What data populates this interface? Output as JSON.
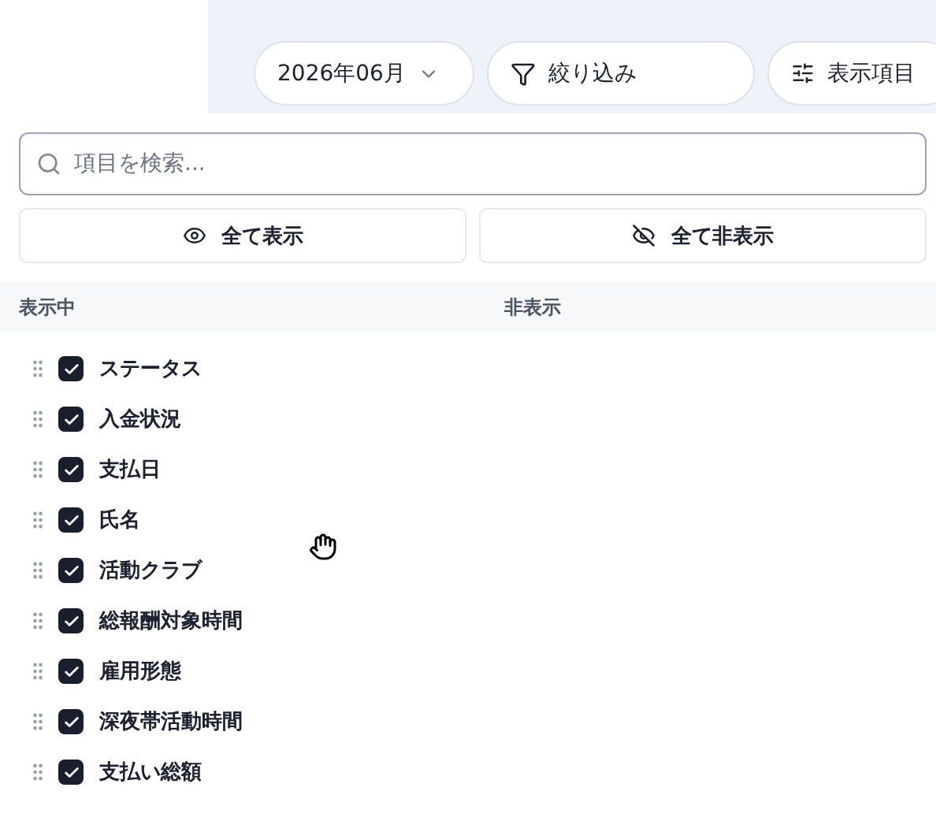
{
  "toolbar": {
    "month": "2026年06月",
    "filter": "絞り込み",
    "columns_button": "表示項目"
  },
  "popup": {
    "search": {
      "placeholder": "項目を検索..."
    },
    "buttons": [
      {
        "kind": "show",
        "label": "全て表示"
      },
      {
        "kind": "hide",
        "label": "全て非表示"
      }
    ],
    "headers": [
      "表示中",
      "非表示"
    ],
    "visible_items": [
      {
        "label": "ステータス",
        "checked": true
      },
      {
        "label": "入金状況",
        "checked": true
      },
      {
        "label": "支払日",
        "checked": true
      },
      {
        "label": "氏名",
        "checked": true
      },
      {
        "label": "活動クラブ",
        "checked": true
      },
      {
        "label": "総報酬対象時間",
        "checked": true
      },
      {
        "label": "雇用形態",
        "checked": true
      },
      {
        "label": "深夜帯活動時間",
        "checked": true
      },
      {
        "label": "支払い総額",
        "checked": true
      }
    ]
  }
}
